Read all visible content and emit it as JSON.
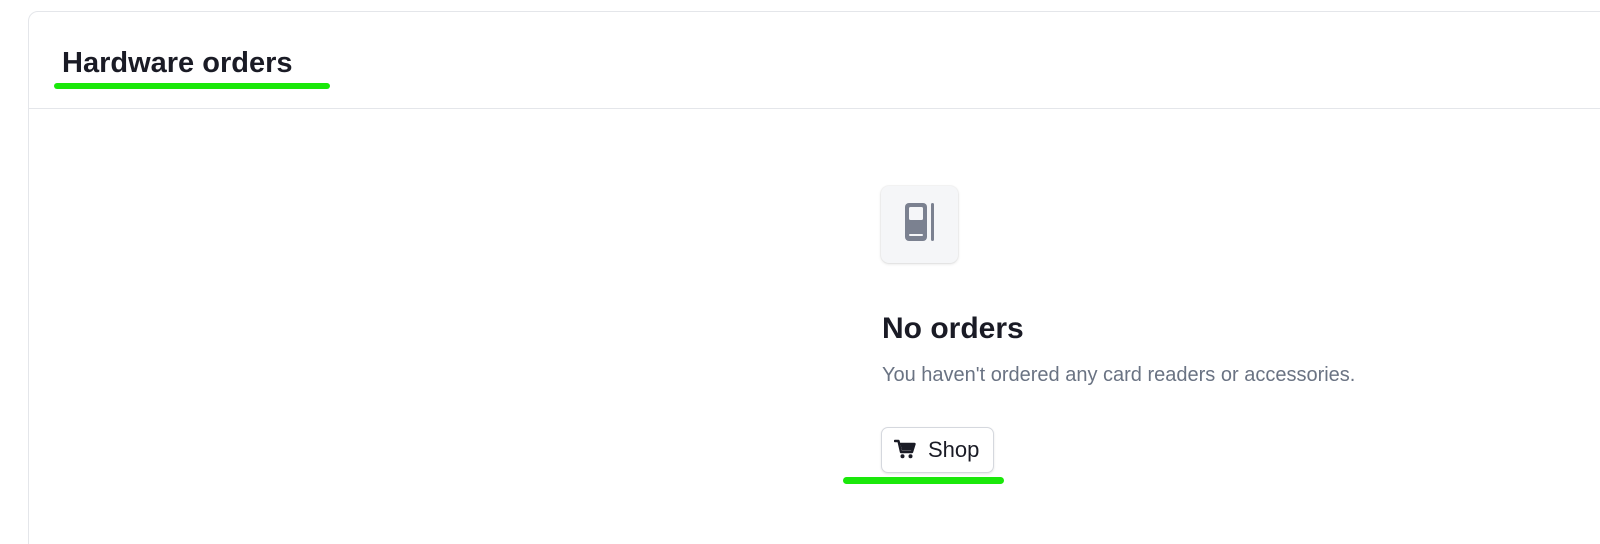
{
  "header": {
    "title": "Hardware orders"
  },
  "empty_state": {
    "icon": "card-reader-icon",
    "title": "No orders",
    "description": "You haven't ordered any card readers or accessories."
  },
  "actions": {
    "shop_label": "Shop",
    "shop_icon": "cart-icon"
  },
  "colors": {
    "highlight": "#1ae80a",
    "title_text": "#1a1b25",
    "muted_text": "#6a7383",
    "icon_fill": "#7b8190",
    "border": "#e4e6ea"
  }
}
